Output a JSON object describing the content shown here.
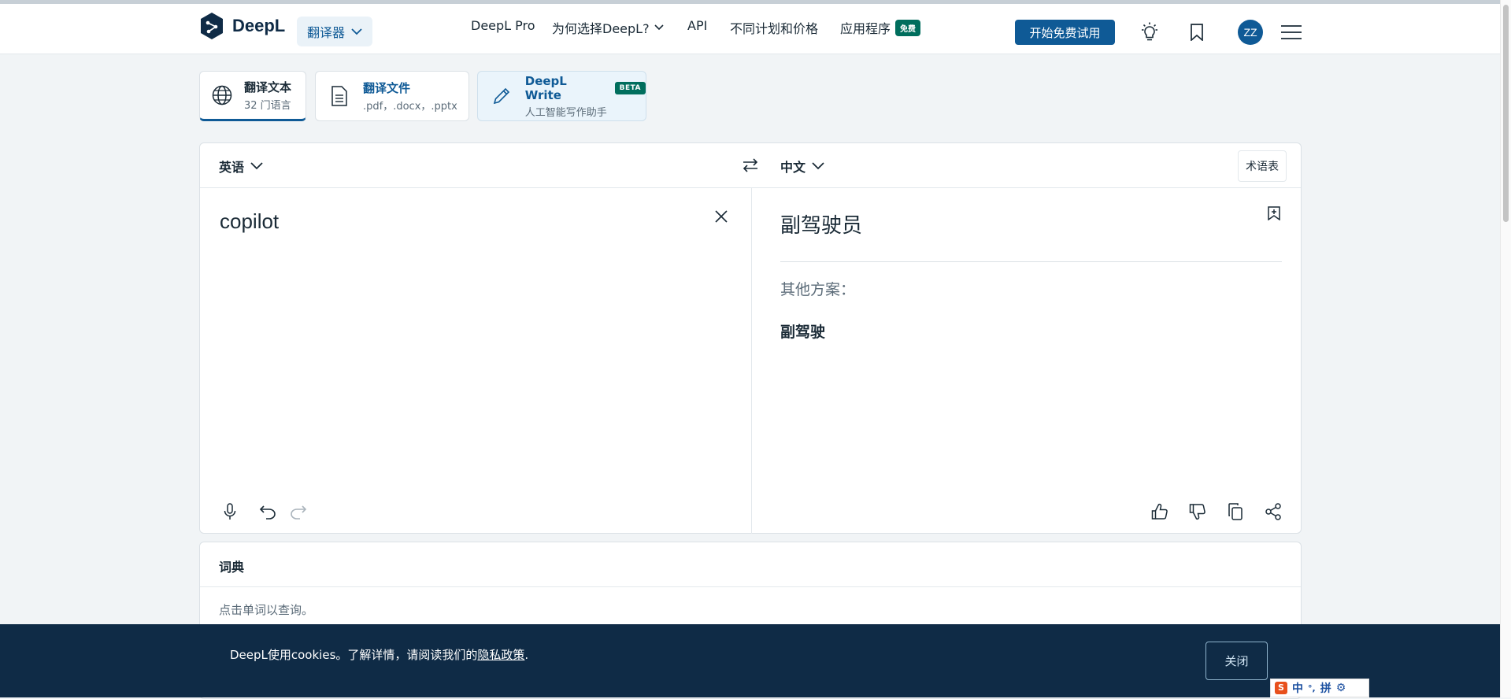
{
  "header": {
    "logo_text": "DeepL",
    "translator_label": "翻译器",
    "nav": [
      {
        "label": "DeepL Pro"
      },
      {
        "label": "为何选择DeepL?"
      },
      {
        "label": "API"
      },
      {
        "label": "不同计划和价格"
      },
      {
        "label": "应用程序"
      }
    ],
    "free_badge": "免费",
    "trial_button": "开始免费试用",
    "avatar_initials": "ZZ"
  },
  "modes": {
    "text_title": "翻译文本",
    "text_sub": "32 门语言",
    "file_title": "翻译文件",
    "file_sub": ".pdf，.docx，.pptx",
    "write_title": "DeepL Write",
    "write_badge": "BETA",
    "write_sub": "人工智能写作助手"
  },
  "translator": {
    "source_lang": "英语",
    "target_lang": "中文",
    "glossary": "术语表",
    "source_text": "copilot",
    "target_text": "副驾驶员",
    "alternatives_label": "其他方案：",
    "alternatives": [
      "副驾驶"
    ]
  },
  "dictionary": {
    "title": "词典",
    "hint": "点击单词以查询。"
  },
  "cookie": {
    "text_before": "DeepL使用cookies。了解详情，请阅读我们的",
    "link": "隐私政策",
    "text_after": ".",
    "close": "关闭"
  },
  "ime": {
    "mode": "中",
    "punct": "°,",
    "pinyin": "拼"
  },
  "colors": {
    "brand_blue": "#0f5a96",
    "navy": "#0f2b46",
    "green_badge": "#006e5d",
    "page_bg": "#f1f4f6"
  }
}
